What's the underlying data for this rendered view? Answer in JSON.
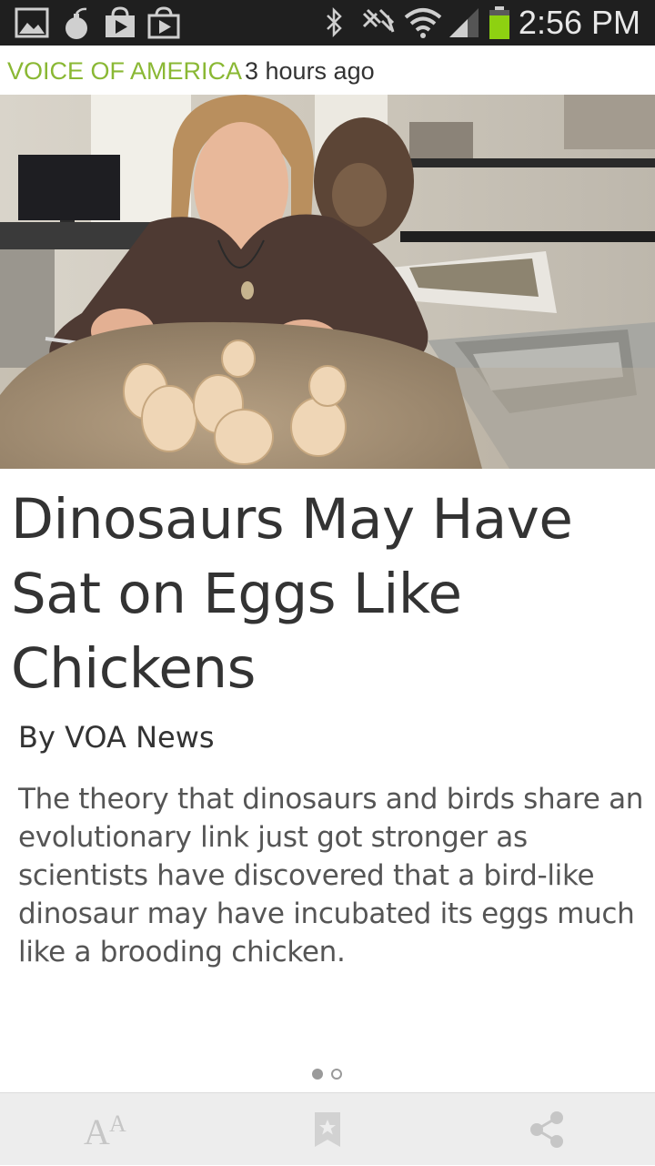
{
  "status_bar": {
    "time": "2:56 PM",
    "icons": [
      "gallery-icon",
      "bomb-icon",
      "play-store-icon",
      "play-store-icon",
      "bluetooth-icon",
      "nfc-icon",
      "wifi-icon",
      "signal-icon",
      "battery-icon"
    ]
  },
  "article": {
    "source": "VOICE OF AMERICA",
    "age": "3 hours ago",
    "headline": "Dinosaurs May Have Sat on Eggs Like Chickens",
    "byline": "By VOA News",
    "summary": "The theory that dinosaurs and birds share an evolutionary link just got stronger as scientists have discovered that a bird-like dinosaur may have incubated its eggs much like a brooding chicken.",
    "image": "scientist-with-dinosaur-eggs-photo"
  },
  "pager": {
    "current_page": 1,
    "total_pages": 2
  },
  "toolbar": {
    "items": [
      "text-size-icon",
      "bookmark-icon",
      "share-icon"
    ]
  },
  "colors": {
    "accent": "#8ab834",
    "status_bar": "#1f1f1f",
    "toolbar": "#ededed",
    "text_dark": "#333333",
    "text_body": "#555555"
  }
}
